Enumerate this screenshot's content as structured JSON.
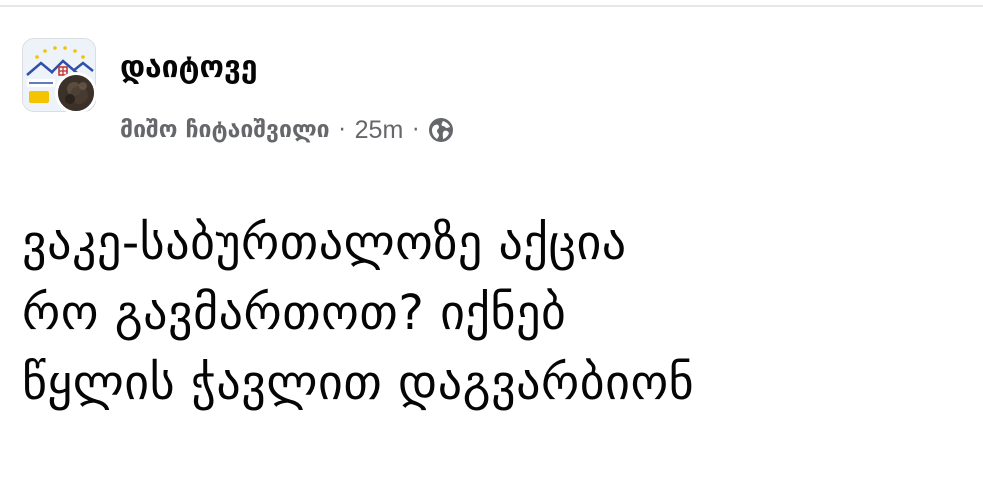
{
  "post": {
    "group_name": "დაიტოვე",
    "author": "მიშო ჩიტაიშვილი",
    "separator": "·",
    "time": "25m",
    "privacy_icon": "globe-icon",
    "body_lines": [
      "ვაკე-საბურთალოზე აქცია",
      "რო გავმართოთ? იქნებ",
      "წყლის ჭავლით დაგვარბიონ"
    ]
  },
  "colors": {
    "primary_text": "#050505",
    "secondary_text": "#65676b",
    "divider": "#e4e6ea"
  }
}
